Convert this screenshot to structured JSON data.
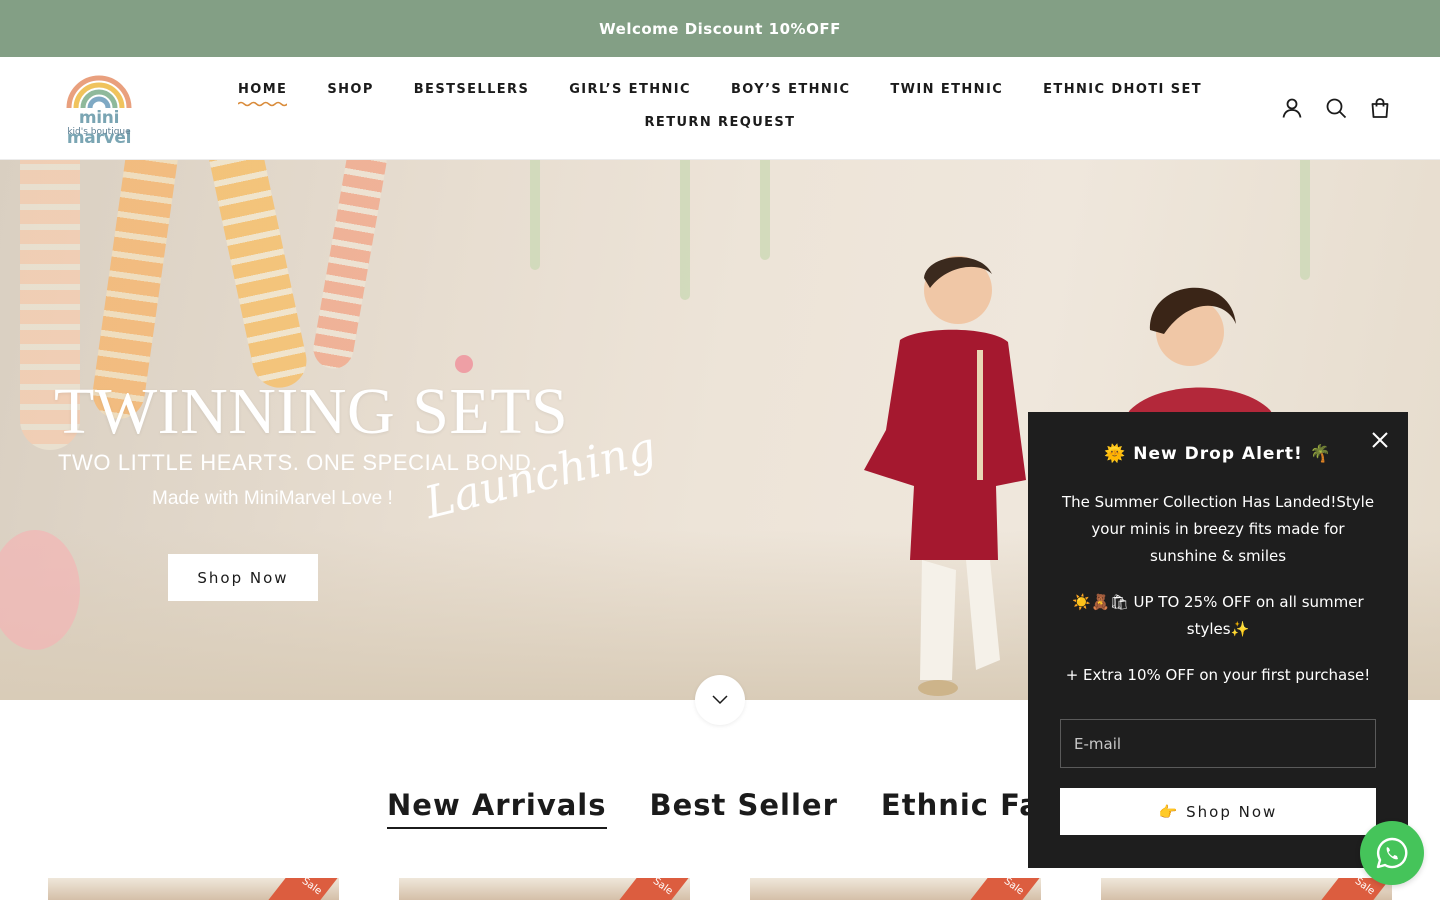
{
  "announcement": {
    "text": "Welcome Discount 10%OFF"
  },
  "logo": {
    "name": "mini marvel",
    "tagline": "kid's boutique"
  },
  "nav": {
    "row1": [
      "HOME",
      "SHOP",
      "BESTSELLERS",
      "GIRL’S ETHNIC",
      "BOY’S ETHNIC",
      "TWIN ETHNIC",
      "ETHNIC DHOTI SET"
    ],
    "row2": [
      "RETURN REQUEST"
    ],
    "active": "HOME"
  },
  "header_icons": [
    "account-icon",
    "search-icon",
    "cart-icon"
  ],
  "hero": {
    "script": "Launching",
    "title": "TWINNING SETS",
    "subtitle": "TWO LITTLE HEARTS. ONE SPECIAL BOND.",
    "tagline": "Made with MiniMarvel Love !",
    "button": "Shop Now"
  },
  "tabs": {
    "items": [
      "New Arrivals",
      "Best Seller",
      "Ethnic Favorite"
    ],
    "active": "New Arrivals"
  },
  "products": [
    {
      "badge": "Sale"
    },
    {
      "badge": "Sale"
    },
    {
      "badge": "Sale"
    },
    {
      "badge": "Sale"
    }
  ],
  "popup": {
    "title": "🌞 New Drop Alert! 🌴",
    "body1": "The Summer Collection Has Landed!Style your minis in breezy fits made for sunshine & smiles",
    "body2": "☀️🧸🛍 UP TO 25% OFF on all summer styles✨",
    "body3": "+ Extra 10% OFF on your first purchase!",
    "email_placeholder": "E-mail",
    "button": "👉 Shop Now"
  },
  "colors": {
    "announcement_bg": "#839f85",
    "popup_bg": "#1e1e1e",
    "whatsapp": "#45c45a",
    "sale_badge": "#dc5d3f"
  }
}
